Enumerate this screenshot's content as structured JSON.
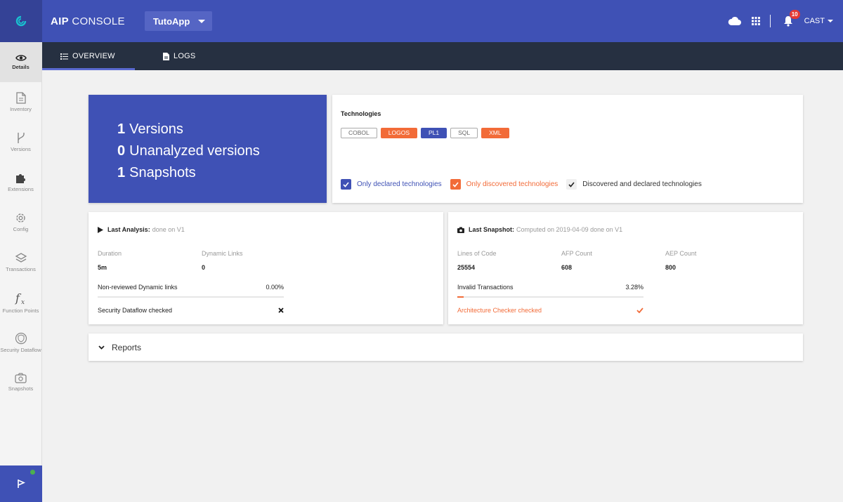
{
  "topbar": {
    "brand_bold": "AIP",
    "brand_light": "CONSOLE",
    "app_name": "TutoApp",
    "notification_count": "10",
    "user": "CAST"
  },
  "sidebar": {
    "items": [
      {
        "label": "Details",
        "icon": "eye-icon"
      },
      {
        "label": "Inventory",
        "icon": "document-icon"
      },
      {
        "label": "Versions",
        "icon": "branch-icon"
      },
      {
        "label": "Extensions",
        "icon": "puzzle-icon"
      },
      {
        "label": "Config",
        "icon": "gear-icon"
      },
      {
        "label": "Transactions",
        "icon": "transactions-icon"
      },
      {
        "label": "Function Points",
        "icon": "function-icon"
      },
      {
        "label": "Security Dataflow",
        "icon": "shield-icon"
      },
      {
        "label": "Snapshots",
        "icon": "camera-icon"
      }
    ]
  },
  "tabs": {
    "overview": "OVERVIEW",
    "logs": "LOGS"
  },
  "summary": {
    "versions_count": "1",
    "versions_label": "Versions",
    "unanalyzed_count": "0",
    "unanalyzed_label": "Unanalyzed versions",
    "snapshots_count": "1",
    "snapshots_label": "Snapshots"
  },
  "technologies": {
    "title": "Technologies",
    "chips": [
      {
        "label": "COBOL",
        "style": "outline"
      },
      {
        "label": "LOGOS",
        "style": "orange"
      },
      {
        "label": "PL1",
        "style": "blue"
      },
      {
        "label": "SQL",
        "style": "outline"
      },
      {
        "label": "XML",
        "style": "orange"
      }
    ],
    "filters": {
      "declared": "Only declared technologies",
      "discovered": "Only discovered technologies",
      "both": "Discovered and declared technologies"
    },
    "colors": {
      "declared": "#3f51b5",
      "discovered": "#f26b38",
      "both": "#333333"
    }
  },
  "analysis": {
    "title": "Last Analysis:",
    "subtitle": "done on V1",
    "duration_label": "Duration",
    "duration_value": "5m",
    "dynamic_links_label": "Dynamic Links",
    "dynamic_links_value": "0",
    "non_reviewed_label": "Non-reviewed Dynamic links",
    "non_reviewed_value": "0.00%",
    "non_reviewed_fraction": 0.0,
    "security_label": "Security Dataflow checked"
  },
  "snapshot": {
    "title": "Last Snapshot:",
    "subtitle": "Computed on 2019-04-09 done on V1",
    "loc_label": "Lines of Code",
    "loc_value": "25554",
    "afp_label": "AFP Count",
    "afp_value": "608",
    "aep_label": "AEP Count",
    "aep_value": "800",
    "invalid_label": "Invalid Transactions",
    "invalid_value": "3.28%",
    "invalid_fraction": 0.0328,
    "arch_label": "Architecture Checker checked"
  },
  "reports": {
    "label": "Reports"
  }
}
